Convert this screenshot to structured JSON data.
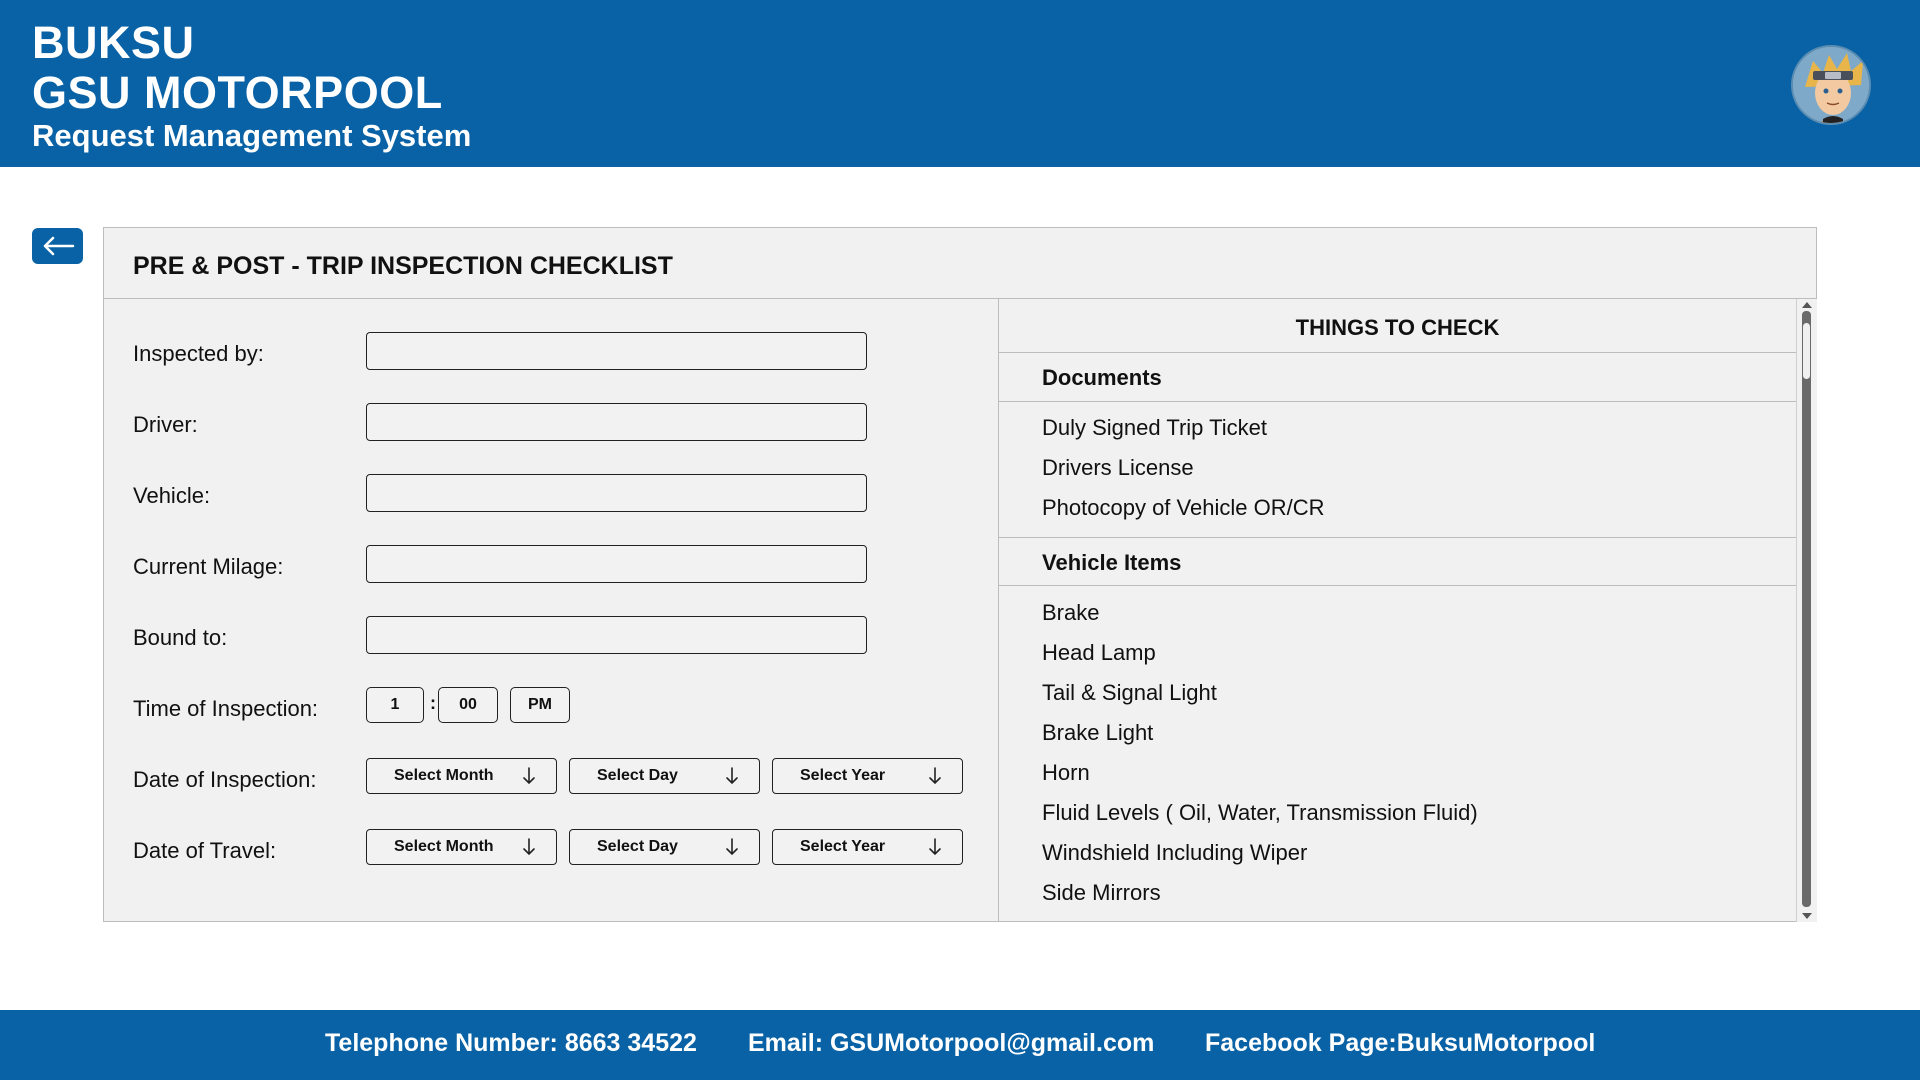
{
  "header": {
    "brand_line1": "BUKSU",
    "brand_line2": "GSU MOTORPOOL",
    "brand_line3": "Request Management System",
    "avatar_icon": "user-avatar-icon"
  },
  "back_button": {
    "icon": "arrow-left-icon"
  },
  "panel": {
    "title": "PRE & POST - TRIP INSPECTION CHECKLIST"
  },
  "form": {
    "inspected_by_label": "Inspected by:",
    "inspected_by_value": "",
    "driver_label": "Driver:",
    "driver_value": "",
    "vehicle_label": "Vehicle:",
    "vehicle_value": "",
    "milage_label": "Current Milage:",
    "milage_value": "",
    "bound_label": "Bound to:",
    "bound_value": "",
    "time_label": "Time of Inspection:",
    "time_hour": "1",
    "time_separator": ":",
    "time_minute": "00",
    "time_ampm": "PM",
    "date_inspection_label": "Date of Inspection:",
    "date_travel_label": "Date of Travel:",
    "select_month": "Select Month",
    "select_day": "Select Day",
    "select_year": "Select Year"
  },
  "checklist": {
    "heading": "THINGS TO CHECK",
    "sections": [
      {
        "title": "Documents",
        "items": [
          "Duly Signed Trip Ticket",
          "Drivers License",
          "Photocopy of Vehicle OR/CR"
        ]
      },
      {
        "title": "Vehicle Items",
        "items": [
          "Brake",
          "Head Lamp",
          "Tail & Signal Light",
          "Brake Light",
          "Horn",
          "Fluid Levels ( Oil, Water, Transmission Fluid)",
          "Windshield Including Wiper",
          "Side Mirrors"
        ]
      }
    ]
  },
  "footer": {
    "telephone": "Telephone Number: 8663 34522",
    "email": "Email: GSUMotorpool@gmail.com",
    "facebook": "Facebook Page:BuksuMotorpool"
  },
  "colors": {
    "primary": "#0962a5",
    "panel_bg": "#f1f1f1"
  }
}
